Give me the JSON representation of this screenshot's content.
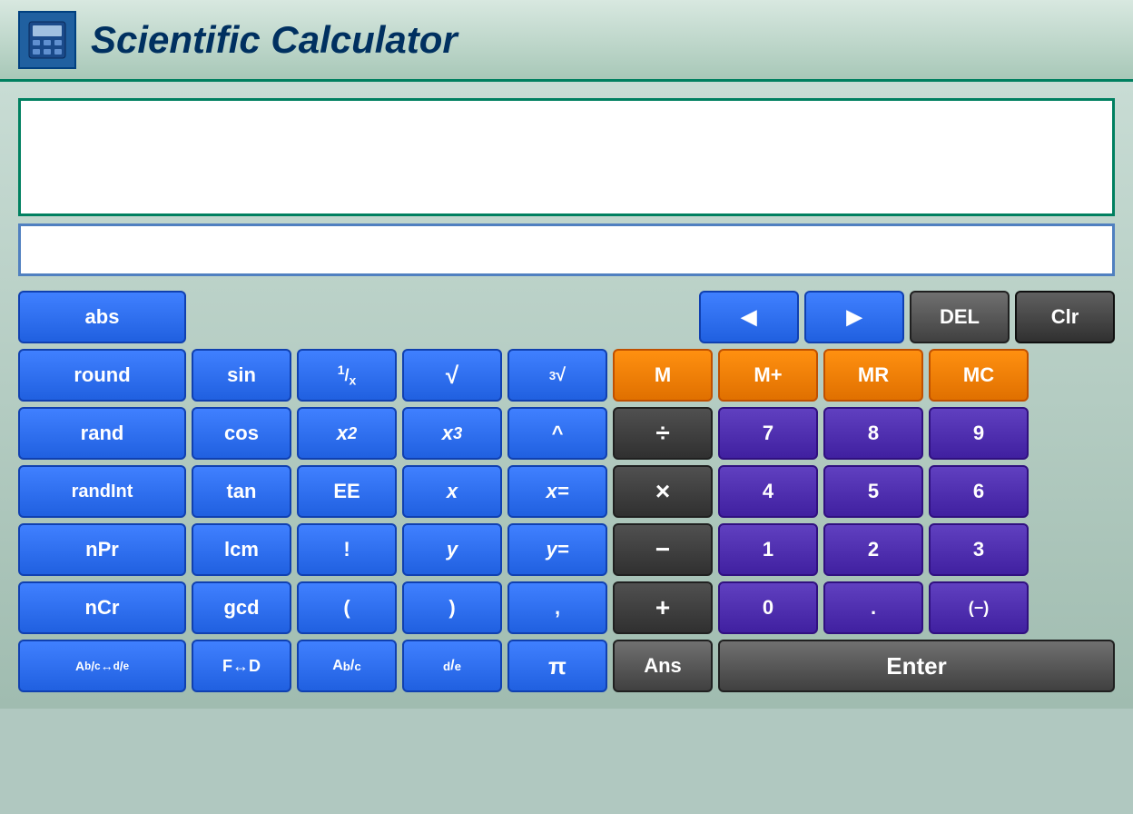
{
  "title": "Scientific Calculator",
  "buttons": {
    "abs": "abs",
    "left_arrow": "◀",
    "right_arrow": "▶",
    "del": "DEL",
    "clr": "Clr",
    "round": "round",
    "sin": "sin",
    "inv": "1/x",
    "sqrt": "√",
    "cbrt": "³√",
    "M": "M",
    "Mplus": "M+",
    "MR": "MR",
    "MC": "MC",
    "rand": "rand",
    "cos": "cos",
    "x2": "x²",
    "x3": "x³",
    "caret": "^",
    "divide": "÷",
    "seven": "7",
    "eight": "8",
    "nine": "9",
    "randInt": "randInt",
    "tan": "tan",
    "EE": "EE",
    "x_var": "x",
    "x_eq": "x=",
    "multiply": "×",
    "four": "4",
    "five": "5",
    "six": "6",
    "nPr": "nPr",
    "lcm": "lcm",
    "factorial": "!",
    "y_var": "y",
    "y_eq": "y=",
    "minus": "−",
    "one": "1",
    "two": "2",
    "three": "3",
    "nCr": "nCr",
    "gcd": "gcd",
    "lparen": "(",
    "rparen": ")",
    "comma": ",",
    "plus": "+",
    "zero": "0",
    "dot": ".",
    "neg": "(−)",
    "abcde": "A b/c ↔ d/e",
    "ftod": "F↔D",
    "abc": "A b/c",
    "de": "d/e",
    "pi": "π",
    "ans": "Ans",
    "enter": "Enter"
  }
}
